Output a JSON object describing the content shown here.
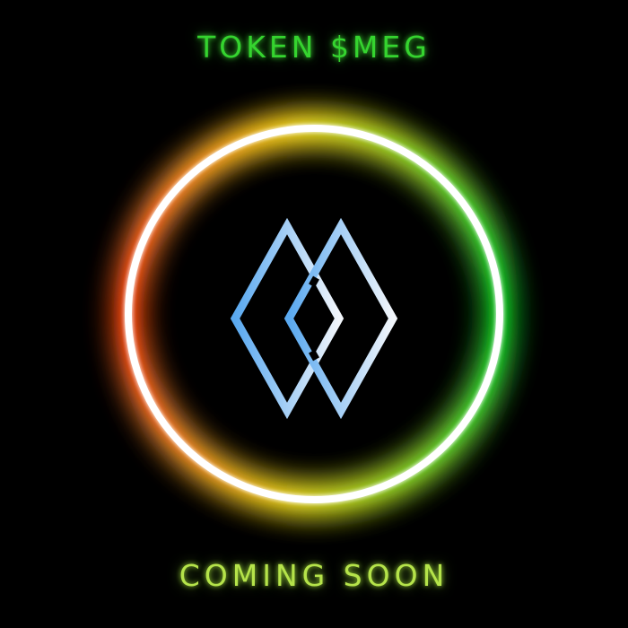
{
  "title": "TOKEN $MEG",
  "subtitle": "COMING SOON",
  "logo": {
    "icon": "double-diamond-logo-icon",
    "gradient_start": "#5aa9f0",
    "gradient_end": "#f2f6fb"
  },
  "ring": {
    "color": "#ffffff",
    "glow_left": "#ff5a12",
    "glow_top": "#e8d21a",
    "glow_right": "#17d41a",
    "glow_bottom": "#c8c81a"
  },
  "colors": {
    "background": "#000000",
    "title": "#35d42f",
    "subtitle": "#b5e34a"
  }
}
